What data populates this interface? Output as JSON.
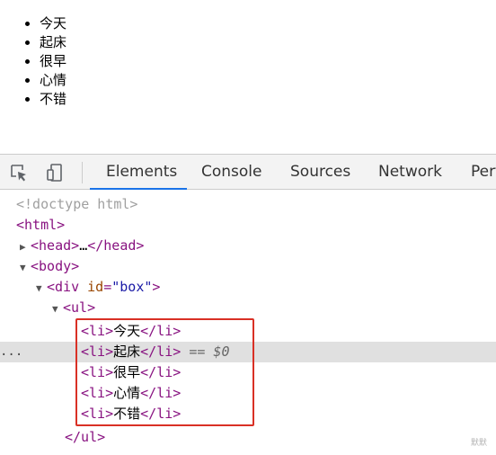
{
  "rendered_list": {
    "items": [
      "今天",
      "起床",
      "很早",
      "心情",
      "不错"
    ]
  },
  "devtools": {
    "toolbar": {
      "inspect_icon": "inspect-element-icon",
      "device_icon": "device-toolbar-icon",
      "tabs": [
        "Elements",
        "Console",
        "Sources",
        "Network",
        "Perf"
      ],
      "active_tab": "Elements"
    },
    "dom": {
      "doctype": "<!doctype html>",
      "html_open": "<html>",
      "head_open": "<head>",
      "head_ellipsis": "…",
      "head_close": "</head>",
      "body_open": "<body>",
      "div_open_start": "<div ",
      "div_attr_name": "id",
      "div_attr_eq": "=",
      "div_attr_value": "\"box\"",
      "div_open_end": ">",
      "ul_open": "<ul>",
      "li_open": "<li>",
      "li_close": "</li>",
      "li_texts": [
        "今天",
        "起床",
        "很早",
        "心情",
        "不错"
      ],
      "selected_marker": "== $0",
      "ul_close": "</ul>",
      "row_dots": "..."
    },
    "highlight_color": "#d93025",
    "selected_row_color": "#e0e0e0"
  },
  "watermark": "默默"
}
